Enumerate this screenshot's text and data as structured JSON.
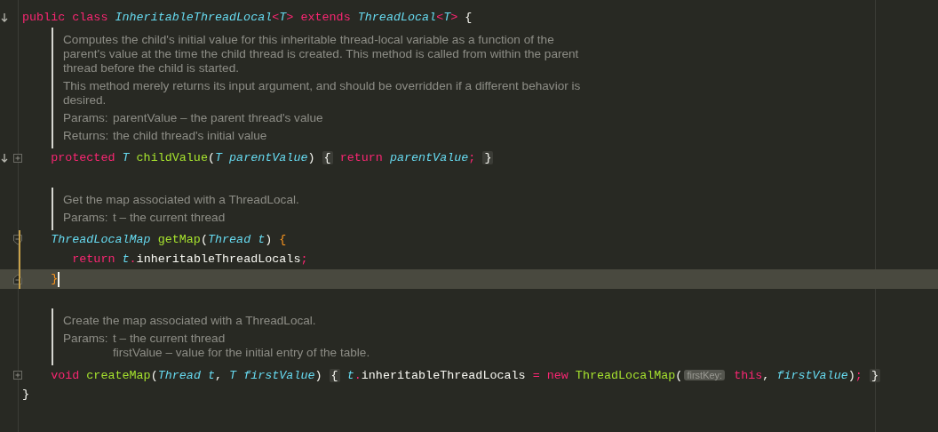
{
  "editor": {
    "lines": [
      {
        "kind": "code",
        "gutter": [
          {
            "kind": "override"
          }
        ],
        "modified": false,
        "current": false,
        "tokens": [
          {
            "text": "public class ",
            "kind": "keyword"
          },
          {
            "text": "InheritableThreadLocal",
            "kind": "type"
          },
          {
            "text": "<",
            "kind": "keyword"
          },
          {
            "text": "T",
            "kind": "type"
          },
          {
            "text": ">",
            "kind": "keyword"
          },
          {
            "text": " extends ",
            "kind": "keyword"
          },
          {
            "text": "ThreadLocal",
            "kind": "type"
          },
          {
            "text": "<",
            "kind": "keyword"
          },
          {
            "text": "T",
            "kind": "type"
          },
          {
            "text": ">",
            "kind": "keyword"
          },
          {
            "text": " {",
            "kind": "plain"
          }
        ]
      },
      {
        "kind": "doc",
        "entries": [
          {
            "kind": "para",
            "text": "Computes the child's initial value for this inheritable thread-local variable as a function of the parent's value at the time the child thread is created. This method is called from within the parent thread before the child is started."
          },
          {
            "kind": "para",
            "text": "This method merely returns its input argument, and should be overridden if a different behavior is desired."
          },
          {
            "kind": "tag",
            "label": "Params:",
            "values": [
              "parentValue – the parent thread's value"
            ]
          },
          {
            "kind": "tag",
            "label": "Returns:",
            "values": [
              "the child thread's initial value"
            ]
          }
        ]
      },
      {
        "kind": "code",
        "gutter": [
          {
            "kind": "override"
          },
          {
            "kind": "fold_expand"
          }
        ],
        "modified": false,
        "current": false,
        "tokens": [
          {
            "text": "    protected ",
            "kind": "keyword"
          },
          {
            "text": "T ",
            "kind": "type"
          },
          {
            "text": "childValue",
            "kind": "method"
          },
          {
            "text": "(",
            "kind": "plain"
          },
          {
            "text": "T",
            "kind": "type"
          },
          {
            "text": " parentValue",
            "kind": "param"
          },
          {
            "text": ") ",
            "kind": "plain"
          },
          {
            "text": "{",
            "kind": "fold"
          },
          {
            "text": " return ",
            "kind": "keyword"
          },
          {
            "text": "parentValue",
            "kind": "param"
          },
          {
            "text": "; ",
            "kind": "keyword"
          },
          {
            "text": "}",
            "kind": "fold"
          }
        ]
      },
      {
        "kind": "blank",
        "modified": false,
        "current": false
      },
      {
        "kind": "doc",
        "entries": [
          {
            "kind": "para",
            "text": "Get the map associated with a ThreadLocal."
          },
          {
            "kind": "tag",
            "label": "Params:",
            "values": [
              "t – the current thread"
            ]
          }
        ]
      },
      {
        "kind": "code",
        "gutter": [
          {
            "kind": "fold_collapse"
          }
        ],
        "modified": true,
        "current": false,
        "tokens": [
          {
            "text": "    ThreadLocalMap ",
            "kind": "type"
          },
          {
            "text": "getMap",
            "kind": "method"
          },
          {
            "text": "(",
            "kind": "plain"
          },
          {
            "text": "Thread",
            "kind": "type"
          },
          {
            "text": " t",
            "kind": "param"
          },
          {
            "text": ") ",
            "kind": "plain"
          },
          {
            "text": "{",
            "kind": "accent"
          }
        ]
      },
      {
        "kind": "code",
        "modified": true,
        "current": false,
        "tokens": [
          {
            "text": "       return ",
            "kind": "keyword"
          },
          {
            "text": "t",
            "kind": "param"
          },
          {
            "text": ".",
            "kind": "keyword"
          },
          {
            "text": "inheritableThreadLocals",
            "kind": "plain"
          },
          {
            "text": ";",
            "kind": "keyword"
          }
        ]
      },
      {
        "kind": "code",
        "gutter": [
          {
            "kind": "fold_end"
          }
        ],
        "modified": true,
        "current": true,
        "tokens": [
          {
            "text": "    }",
            "kind": "accent"
          }
        ]
      },
      {
        "kind": "blank",
        "modified": false,
        "current": false
      },
      {
        "kind": "doc",
        "entries": [
          {
            "kind": "para",
            "text": "Create the map associated with a ThreadLocal."
          },
          {
            "kind": "tag",
            "label": "Params:",
            "values": [
              "t – the current thread",
              "firstValue – value for the initial entry of the table."
            ]
          }
        ]
      },
      {
        "kind": "code",
        "gutter": [
          {
            "kind": "fold_expand"
          }
        ],
        "modified": false,
        "current": false,
        "tokens": [
          {
            "text": "    void ",
            "kind": "keyword"
          },
          {
            "text": "createMap",
            "kind": "method"
          },
          {
            "text": "(",
            "kind": "plain"
          },
          {
            "text": "Thread",
            "kind": "type"
          },
          {
            "text": " t",
            "kind": "param"
          },
          {
            "text": ", ",
            "kind": "plain"
          },
          {
            "text": "T",
            "kind": "type"
          },
          {
            "text": " firstValue",
            "kind": "param"
          },
          {
            "text": ") ",
            "kind": "plain"
          },
          {
            "text": "{",
            "kind": "fold"
          },
          {
            "text": " t",
            "kind": "param"
          },
          {
            "text": ".",
            "kind": "keyword"
          },
          {
            "text": "inheritableThreadLocals ",
            "kind": "plain"
          },
          {
            "text": "= new ",
            "kind": "keyword"
          },
          {
            "text": "ThreadLocalMap",
            "kind": "method"
          },
          {
            "text": "(",
            "kind": "plain"
          },
          {
            "text": "firstKey:",
            "kind": "hint"
          },
          {
            "text": " this",
            "kind": "keyword"
          },
          {
            "text": ", ",
            "kind": "plain"
          },
          {
            "text": "firstValue",
            "kind": "param"
          },
          {
            "text": ")",
            "kind": "plain"
          },
          {
            "text": "; ",
            "kind": "keyword"
          },
          {
            "text": "}",
            "kind": "fold"
          }
        ]
      },
      {
        "kind": "code",
        "modified": false,
        "current": false,
        "tokens": [
          {
            "text": "}",
            "kind": "plain"
          }
        ]
      }
    ]
  }
}
